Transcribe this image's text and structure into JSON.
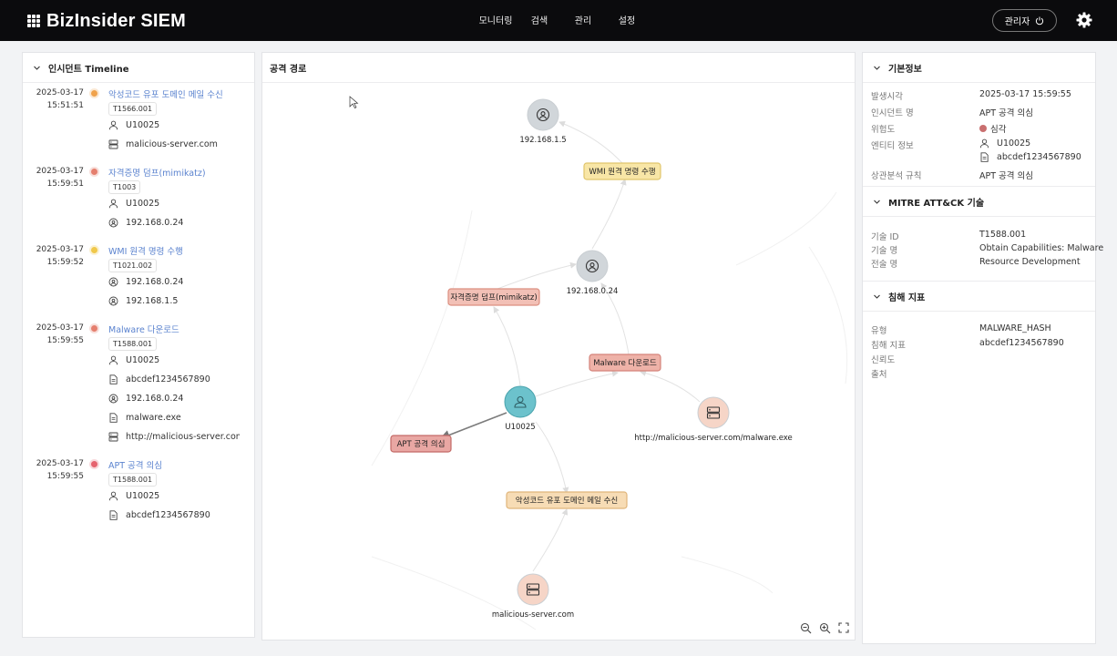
{
  "app": {
    "title": "BizInsider SIEM"
  },
  "nav": [
    "모니터링",
    "검색",
    "관리",
    "설정"
  ],
  "user": {
    "label": "관리자"
  },
  "timeline": {
    "title": "인시던트 Timeline",
    "events": [
      {
        "date": "2025-03-17",
        "time": "15:51:51",
        "title": "악성코드 유포 도메인 메일 수신",
        "code": "T1566.001",
        "color": "#f0a24b",
        "entities": [
          {
            "icon": "user-icon",
            "text": "U10025"
          },
          {
            "icon": "server-icon",
            "text": "malicious-server.com"
          }
        ]
      },
      {
        "date": "2025-03-17",
        "time": "15:59:51",
        "title": "자격증명 덤프(mimikatz)",
        "code": "T1003",
        "color": "#e57f6e",
        "entities": [
          {
            "icon": "user-icon",
            "text": "U10025"
          },
          {
            "icon": "location-icon",
            "text": "192.168.0.24"
          }
        ]
      },
      {
        "date": "2025-03-17",
        "time": "15:59:52",
        "title": "WMI 원격 명령 수행",
        "code": "T1021.002",
        "color": "#f0c84b",
        "entities": [
          {
            "icon": "location-icon",
            "text": "192.168.0.24"
          },
          {
            "icon": "location-icon",
            "text": "192.168.1.5"
          }
        ]
      },
      {
        "date": "2025-03-17",
        "time": "15:59:55",
        "title": "Malware 다운로드",
        "code": "T1588.001",
        "color": "#e57f6e",
        "entities": [
          {
            "icon": "user-icon",
            "text": "U10025"
          },
          {
            "icon": "file-icon",
            "text": "abcdef1234567890"
          },
          {
            "icon": "location-icon",
            "text": "192.168.0.24"
          },
          {
            "icon": "file-icon",
            "text": "malware.exe"
          },
          {
            "icon": "server-icon",
            "text": "http://malicious-server.com/m"
          }
        ]
      },
      {
        "date": "2025-03-17",
        "time": "15:59:55",
        "title": "APT 공격 의심",
        "code": "T1588.001",
        "color": "#e5636e",
        "entities": [
          {
            "icon": "user-icon",
            "text": "U10025"
          },
          {
            "icon": "file-icon",
            "text": "abcdef1234567890"
          }
        ]
      }
    ]
  },
  "graph": {
    "title": "공격 경로",
    "entity_nodes": [
      {
        "id": "ip1",
        "label": "192.168.1.5",
        "kind": "location-icon",
        "color": "#d1d6da"
      },
      {
        "id": "ip2",
        "label": "192.168.0.24",
        "kind": "location-icon",
        "color": "#d1d6da"
      },
      {
        "id": "user",
        "label": "U10025",
        "kind": "user-icon",
        "color": "#6cc2cc"
      },
      {
        "id": "srv1",
        "label": "http://malicious-server.com/malware.exe",
        "kind": "server-icon",
        "color": "#f6d5c7"
      },
      {
        "id": "srv2",
        "label": "malicious-server.com",
        "kind": "server-icon",
        "color": "#f6d5c7"
      }
    ],
    "event_nodes": [
      {
        "id": "wmi",
        "label": "WMI 원격 명령 수행",
        "color": "#f8e6a6",
        "border": "#e0c56c"
      },
      {
        "id": "cred",
        "label": "자격증명 덤프(mimikatz)",
        "color": "#f2c0b6",
        "border": "#dc8f80"
      },
      {
        "id": "malw",
        "label": "Malware 다운로드",
        "color": "#eeb2a8",
        "border": "#d4837a"
      },
      {
        "id": "apt",
        "label": "APT 공격 의심",
        "color": "#e9a7a3",
        "border": "#c36a67"
      },
      {
        "id": "mail",
        "label": "악성코드 유포 도메인 메일 수신",
        "color": "#f7dcb5",
        "border": "#e0b57a"
      }
    ]
  },
  "details": {
    "basic": {
      "title": "기본정보",
      "occurred_label": "발생시각",
      "occurred": "2025-03-17 15:59:55",
      "name_label": "인시던트 명",
      "name": "APT 공격 의심",
      "severity_label": "위험도",
      "severity": "심각",
      "severity_color": "#c96f6f",
      "entity_label": "엔티티 정보",
      "entity_user": "U10025",
      "entity_file": "abcdef1234567890",
      "rule_label": "상관분석 규칙",
      "rule": "APT 공격 의심"
    },
    "mitre": {
      "title": "MITRE ATT&CK 기술",
      "id_label": "기술 ID",
      "id": "T1588.001",
      "name_label": "기술 명",
      "name": "Obtain Capabilities: Malware",
      "tactic_label": "전술 명",
      "tactic": "Resource Development"
    },
    "ioc": {
      "title": "침해 지표",
      "type_label": "유형",
      "type": "MALWARE_HASH",
      "ioc_label": "침해 지표",
      "ioc": "abcdef1234567890",
      "trust_label": "신뢰도",
      "source_label": "출처"
    }
  }
}
